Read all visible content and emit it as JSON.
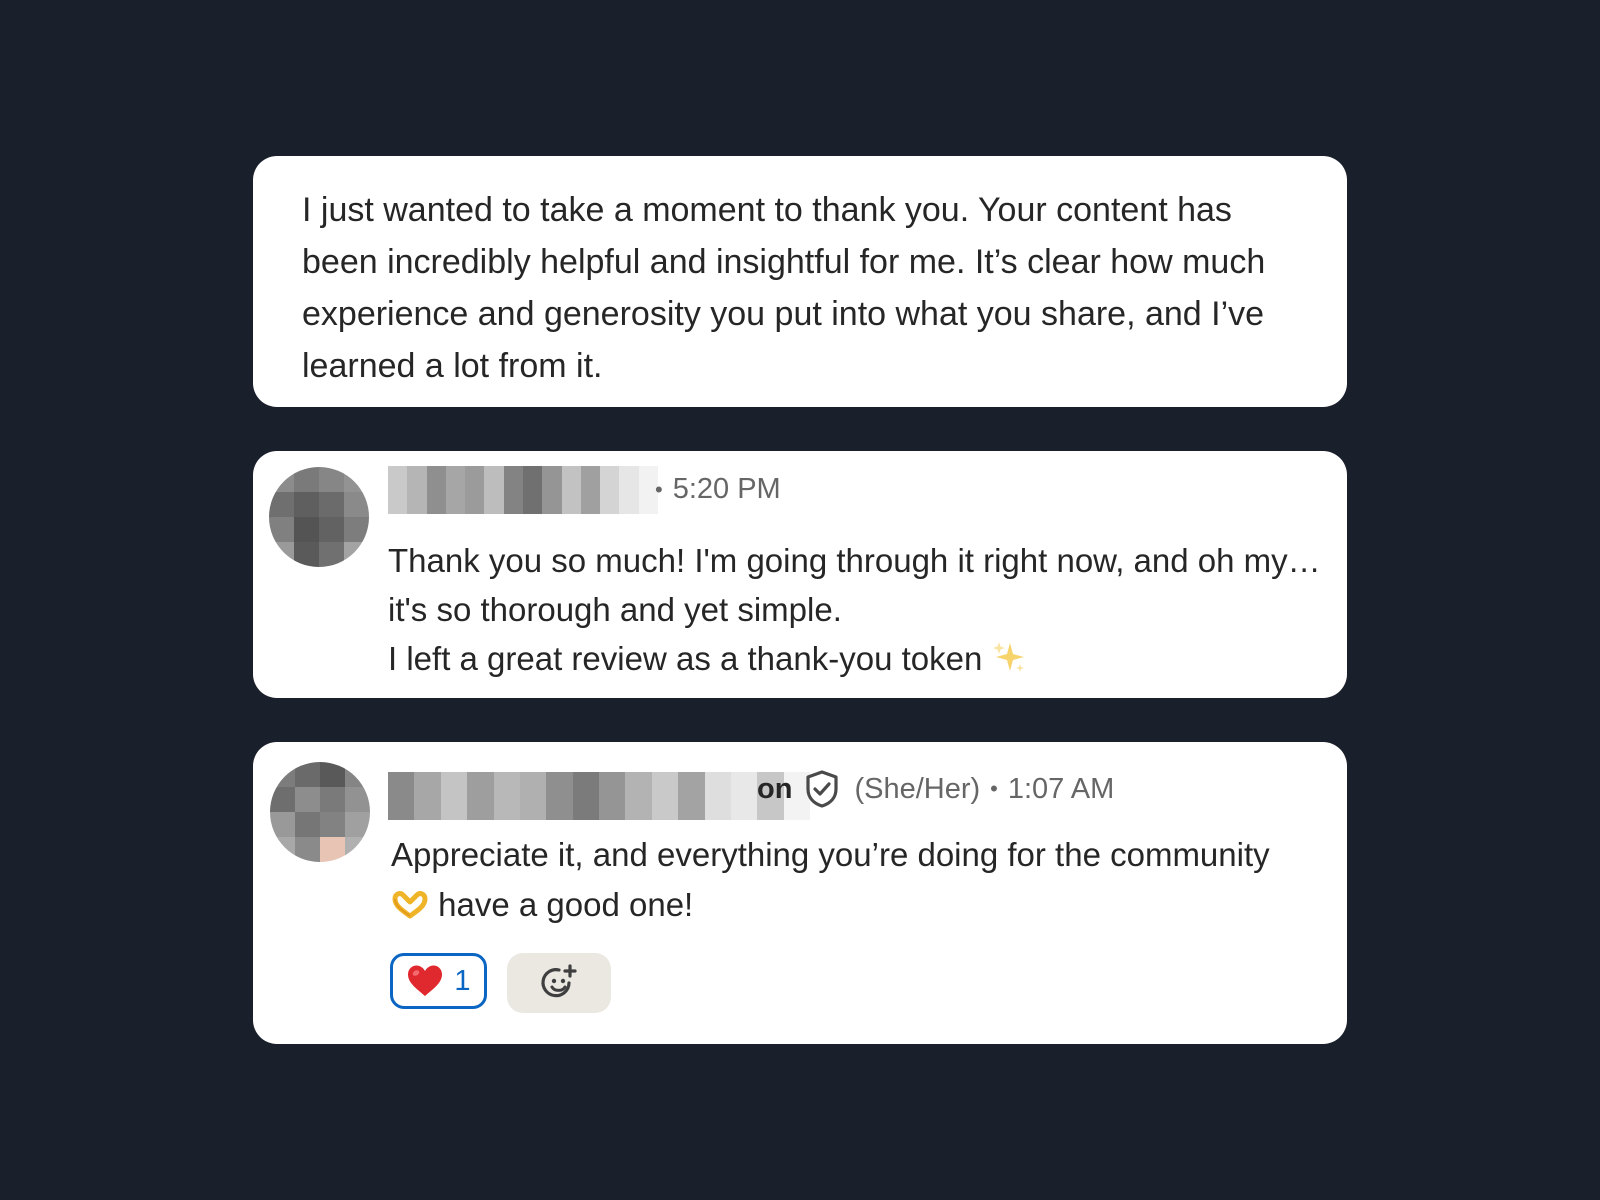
{
  "messages": [
    {
      "text": "I just wanted to take a moment to thank you. Your content has been incredibly helpful and insightful for me. It’s clear how much experience and generosity you put into what you share, and I’ve learned a lot from it."
    },
    {
      "time": "5:20 PM",
      "lines": [
        "Thank you so much! I'm going through it right now, and oh my… it's so thorough and yet simple.",
        "I left a great review as a thank-you token"
      ],
      "emoji_icon": "sparkles-icon"
    },
    {
      "name_suffix": "on",
      "pronouns": "(She/Her)",
      "time": "1:07 AM",
      "text_before_emoji": "Appreciate it, and everything you’re doing for the community",
      "text_after_emoji": " have a good one!",
      "emoji_icon": "heart-hands-icon",
      "verified_icon": "verified-shield-icon",
      "reactions": [
        {
          "icon": "red-heart-icon",
          "count": "1"
        }
      ],
      "add_reaction_icon": "add-reaction-smiley-icon"
    }
  ],
  "colors": {
    "background": "#1a1f2c",
    "card": "#ffffff",
    "reaction_accent": "#0a66c2",
    "add_reaction_bg": "#ebe8e2"
  }
}
